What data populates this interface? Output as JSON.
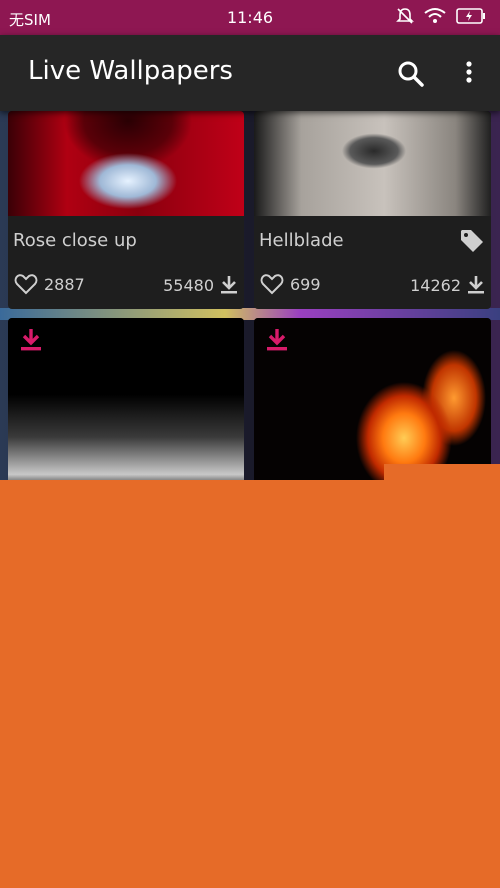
{
  "status_bar": {
    "carrier": "无SIM",
    "time": "11:46",
    "icons": [
      "bell-mute-icon",
      "wifi-icon",
      "battery-charging-icon"
    ]
  },
  "app_bar": {
    "title": "Live Wallpapers",
    "actions": [
      "search-icon",
      "more-vert-icon"
    ]
  },
  "wallpapers": [
    {
      "title": "Rose close up",
      "likes": "2887",
      "downloads": "55480"
    },
    {
      "title": "Hellblade",
      "likes": "699",
      "downloads": "14262",
      "tag_icon": "tag-icon"
    },
    {
      "title": "",
      "badge_icon": "download-icon"
    },
    {
      "title": "",
      "badge_icon": "download-icon"
    }
  ],
  "colors": {
    "status_bar": "#8e1752",
    "app_bar": "#262626",
    "accent_download": "#d81b6a",
    "overlay": "#e66b28"
  }
}
